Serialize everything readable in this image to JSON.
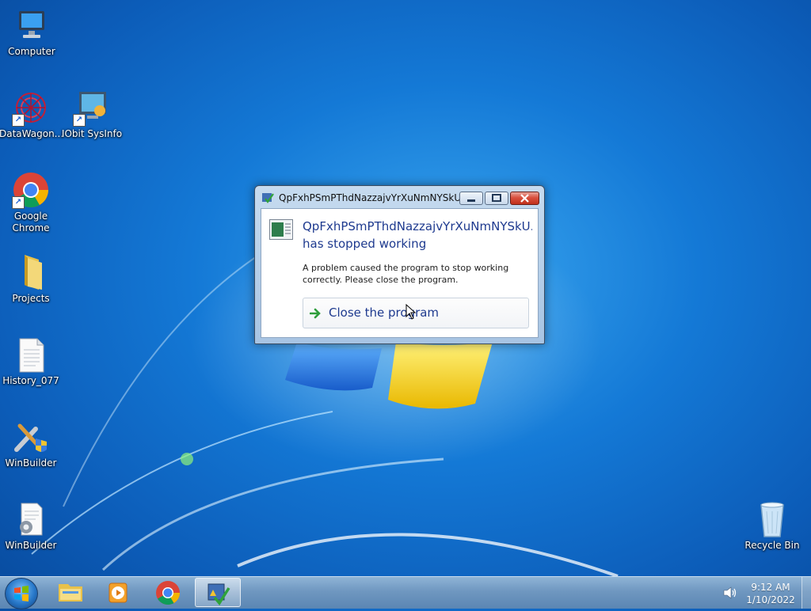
{
  "desktop": {
    "icons": [
      {
        "id": "computer",
        "label": "Computer",
        "icon": "computer-icon"
      },
      {
        "id": "datawagon",
        "label": "DataWagon...",
        "icon": "datawagon-icon",
        "shortcut": true
      },
      {
        "id": "iobit",
        "label": "IObit SysInfo",
        "icon": "monitor-info-icon",
        "shortcut": true
      },
      {
        "id": "chrome",
        "label": "Google\nChrome",
        "icon": "chrome-icon",
        "shortcut": true
      },
      {
        "id": "projects",
        "label": "Projects",
        "icon": "folder-icon"
      },
      {
        "id": "history",
        "label": "History_077",
        "icon": "text-file-icon"
      },
      {
        "id": "winbuilder1",
        "label": "WinBuilder",
        "icon": "winbuilder-tools-icon"
      },
      {
        "id": "winbuilder2",
        "label": "WinBuilder",
        "icon": "winbuilder-script-icon"
      },
      {
        "id": "recycle",
        "label": "Recycle Bin",
        "icon": "recycle-bin-icon"
      }
    ]
  },
  "dialog": {
    "title": "QpFxhPSmPThdNazzajvYrXuNmNYSkU.e...",
    "heading_line1": "QpFxhPSmPThdNazzajvYrXuNmNYSkU....",
    "heading_line2": "has stopped working",
    "description": "A problem caused the program to stop working correctly. Please close the program.",
    "command_label": "Close the program"
  },
  "taskbar": {
    "pinned": [
      "explorer-icon",
      "media-player-icon",
      "chrome-icon",
      "error-reporting-icon"
    ],
    "active_index": 3,
    "clock_time": "9:12 AM",
    "clock_date": "1/10/2022"
  },
  "colors": {
    "accent": "#1e3a8f",
    "desktop": "#1479d6",
    "close_button": "#c0311c"
  }
}
